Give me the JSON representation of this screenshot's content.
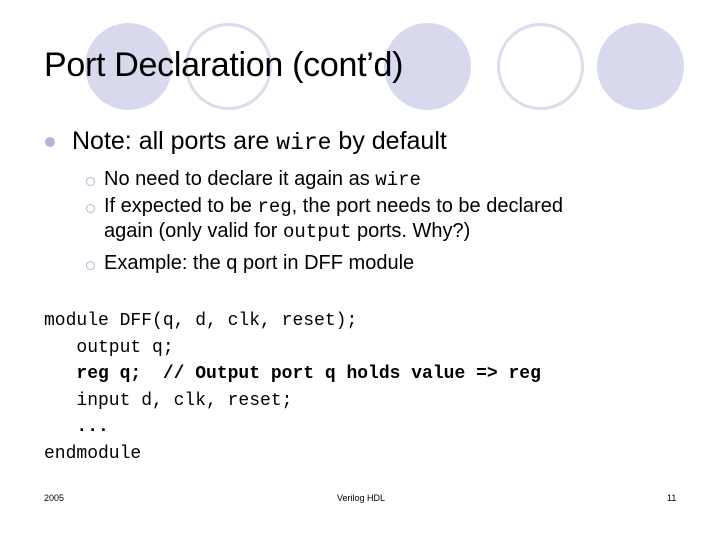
{
  "slide": {
    "title": "Port Declaration (cont’d)",
    "bullet": {
      "text_before": "Note: all ports are ",
      "code": "wire",
      "text_after": " by default"
    },
    "sub_bullets": [
      {
        "text_before": "No need to declare it again as ",
        "code": "wire",
        "text_after": ""
      },
      {
        "text_before": "If expected to be ",
        "code": "reg",
        "text_after": ", the port needs to be declared",
        "line2_before": "again (only valid for ",
        "line2_code": "output",
        "line2_after": " ports. Why?)"
      },
      {
        "text_before": "Example: the q port in DFF module",
        "code": "",
        "text_after": ""
      }
    ],
    "code_lines": [
      {
        "text": "module DFF(q, d, clk, reset);",
        "bold": false
      },
      {
        "text": "   output q;",
        "bold": false
      },
      {
        "text": "   reg q;  // Output port q holds value => reg",
        "bold": true
      },
      {
        "text": "   input d, clk, reset;",
        "bold": false
      },
      {
        "text": "   ...",
        "bold": true
      },
      {
        "text": "endmodule",
        "bold": false
      }
    ]
  },
  "footer": {
    "left": "2005",
    "center": "Verilog HDL",
    "right": "11"
  },
  "colors": {
    "circle_fill": "#d9d9ee",
    "circle_outline": "#dcdcec",
    "bullet": "#b4b4dc"
  }
}
